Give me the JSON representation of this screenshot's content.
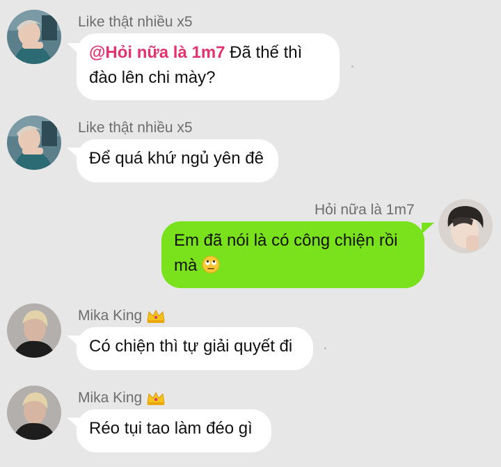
{
  "messages": [
    {
      "sender": "Like thật nhiều x5",
      "mention": "@Hỏi nữa là 1m7",
      "text_after_mention": " Đã thế thì",
      "line2": "đào lên chi mày?",
      "avatar_icon": "avatar-photo-gray-hair"
    },
    {
      "sender": "Like thật nhiều x5",
      "text": "Để quá khứ ngủ yên đê",
      "avatar_icon": "avatar-photo-gray-hair"
    },
    {
      "sender": "Hỏi nữa là 1m7",
      "line1": "Em đã nói là có công chiện rồi",
      "line2": "mà",
      "emoji": "eye-roll-emoji",
      "avatar_icon": "avatar-photo-dark-hair"
    },
    {
      "sender": "Mika King",
      "badge": "crown-icon",
      "text": "Có chiện thì tự giải quyết đi",
      "avatar_icon": "avatar-photo-blonde"
    },
    {
      "sender": "Mika King",
      "badge": "crown-icon",
      "text": "Réo tụi tao làm đéo gì",
      "avatar_icon": "avatar-photo-blonde"
    }
  ],
  "colors": {
    "background": "#e7e7e7",
    "incoming_bubble": "#ffffff",
    "outgoing_bubble": "#7ae21c",
    "mention": "#e2336f",
    "sender_name": "#6d6d6d"
  }
}
